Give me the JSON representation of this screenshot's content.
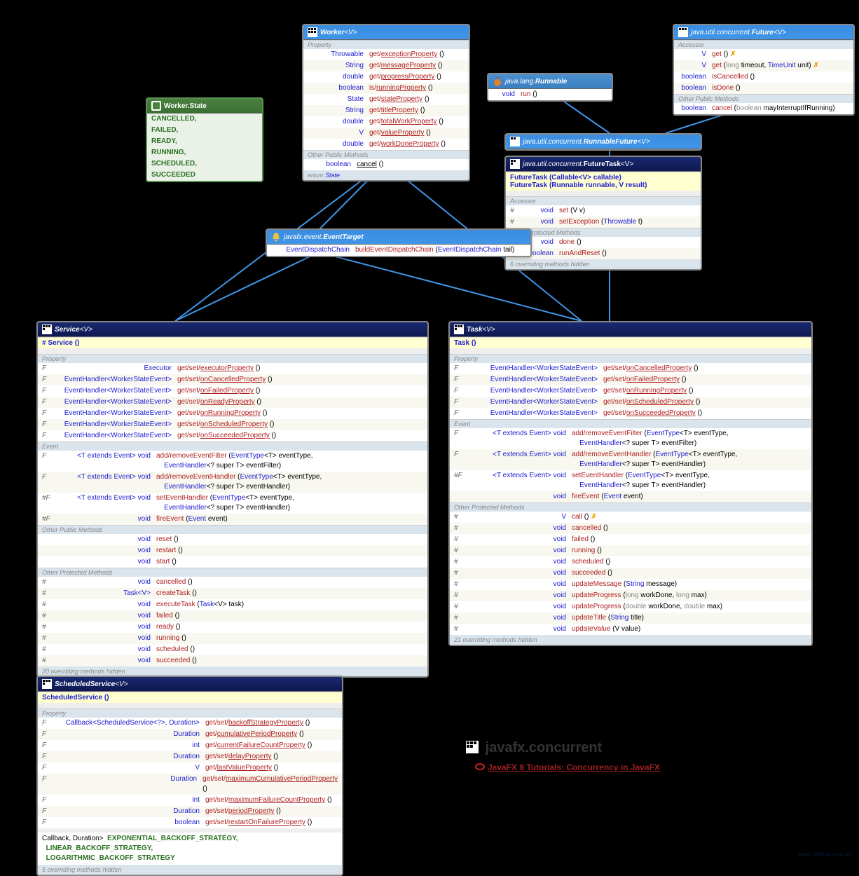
{
  "pkg_title": "javafx.concurrent",
  "tutorial_link": "JavaFX 8 Tutorials: Concurrency in JavaFX",
  "watermark": "www.falkhausen.de",
  "worker_state": {
    "title": "Worker.State",
    "items": [
      "CANCELLED,",
      "FAILED,",
      "READY,",
      "RUNNING,",
      "SCHEDULED,",
      "SUCCEEDED"
    ]
  },
  "worker": {
    "title_pre": "Worker",
    "title_post": "<V>",
    "sect_prop": "Property",
    "props": [
      {
        "ret": "Throwable",
        "sig": "get/<u>exceptionProperty</u> ()"
      },
      {
        "ret": "String",
        "sig": "get/<u>messageProperty</u> ()"
      },
      {
        "ret": "double",
        "sig": "get/<u>progressProperty</u> ()"
      },
      {
        "ret": "boolean",
        "sig": "is/<u>runningProperty</u> ()"
      },
      {
        "ret": "State",
        "sig": "get/<u>stateProperty</u> ()"
      },
      {
        "ret": "String",
        "sig": "get/<u>titleProperty</u> ()"
      },
      {
        "ret": "double",
        "sig": "get/<u>totalWorkProperty</u> ()"
      },
      {
        "ret": "V",
        "sig": "get/<u>valueProperty</u> ()"
      },
      {
        "ret": "double",
        "sig": "get/<u>workDoneProperty</u> ()"
      }
    ],
    "sect_other": "Other Public Methods",
    "other": [
      {
        "ret": "boolean",
        "sig": "<u>cancel</u> ()"
      }
    ],
    "foot": "enum <span class='type'>State</span>"
  },
  "runnable": {
    "title_pkg": "java.lang.",
    "title": "Runnable",
    "row": {
      "ret": "void",
      "sig": "<span class='m-name'>run</span> ()"
    }
  },
  "future": {
    "title_pkg": "java.util.concurrent.",
    "title_pre": "Future",
    "title_post": "<V>",
    "sect": "Accessor",
    "rows": [
      {
        "ret": "V",
        "sig": "<span class='m-name'>get</span> () <span class='excl'>✗</span>"
      },
      {
        "ret": "V",
        "sig": "<span class='m-name'>get</span> (<span class='kw'>long</span> timeout, <span class='type'>TimeUnit</span> unit) <span class='excl'>✗</span>"
      },
      {
        "ret": "boolean",
        "sig": "<span class='m-name'>isCancelled</span> ()"
      },
      {
        "ret": "boolean",
        "sig": "<span class='m-name'>isDone</span> ()"
      }
    ],
    "sect2": "Other Public Methods",
    "rows2": [
      {
        "ret": "boolean",
        "sig": "<span class='m-name'>cancel</span> (<span class='kw'>boolean</span> mayInterruptIfRunning)"
      }
    ]
  },
  "runnablefuture": {
    "title_pkg": "java.util.concurrent.",
    "title_pre": "RunnableFuture",
    "title_post": "<V>"
  },
  "futuretask": {
    "title_pkg": "java.util.concurrent.",
    "title_pre": "FutureTask",
    "title_post": "<V>",
    "constr": [
      "<span class='type'>FutureTask</span> (<span class='type'>Callable</span>&lt;V&gt; callable)",
      "<span class='type'>FutureTask</span> (<span class='type'>Runnable</span> runnable, V result)"
    ],
    "sect": "Accessor",
    "rows": [
      {
        "mod": "#",
        "ret": "void",
        "sig": "<span class='m-name'>set</span> (V v)"
      },
      {
        "mod": "#",
        "ret": "void",
        "sig": "<span class='m-name'>setException</span> (<span class='type'>Throwable</span> t)"
      }
    ],
    "sect2": "Other Protected Methods",
    "rows2": [
      {
        "mod": "#",
        "ret": "void",
        "sig": "<span class='m-name'>done</span> ()"
      },
      {
        "mod": "#",
        "ret": "boolean",
        "sig": "<span class='m-name'>runAndReset</span> ()"
      }
    ],
    "foot": "6 overriding <span class='note'>methods hidden</span>"
  },
  "eventtarget": {
    "title_pkg": "javafx.event.",
    "title": "EventTarget",
    "row": {
      "ret": "EventDispatchChain",
      "sig": "<span class='m-name'>buildEventDispatchChain</span> (<span class='type'>EventDispatchChain</span> tail)"
    }
  },
  "service": {
    "title_pre": "Service",
    "title_post": "<V>",
    "constr": "# <span class='type'>Service</span> ()",
    "sect_prop": "Property",
    "props": [
      {
        "mod": "F",
        "ret": "Executor",
        "sig": "get/set/<u>executorProperty</u> ()"
      },
      {
        "mod": "F",
        "ret": "EventHandler<WorkerStateEvent>",
        "sig": "get/set/<u>onCancelledProperty</u> ()"
      },
      {
        "mod": "F",
        "ret": "EventHandler<WorkerStateEvent>",
        "sig": "get/set/<u>onFailedProperty</u> ()"
      },
      {
        "mod": "F",
        "ret": "EventHandler<WorkerStateEvent>",
        "sig": "get/set/<u>onReadyProperty</u> ()"
      },
      {
        "mod": "F",
        "ret": "EventHandler<WorkerStateEvent>",
        "sig": "get/set/<u>onRunningProperty</u> ()"
      },
      {
        "mod": "F",
        "ret": "EventHandler<WorkerStateEvent>",
        "sig": "get/set/<u>onScheduledProperty</u> ()"
      },
      {
        "mod": "F",
        "ret": "EventHandler<WorkerStateEvent>",
        "sig": "get/set/<u>onSucceededProperty</u> ()"
      }
    ],
    "sect_event": "Event",
    "events": [
      {
        "mod": "F",
        "ret": "<T extends Event> void",
        "sig": "<span class='m-name'>add/removeEventFilter</span> (<span class='type'>EventType</span>&lt;T&gt; eventType,<br>&nbsp;&nbsp;&nbsp;&nbsp;<span class='type'>EventHandler</span>&lt;? super T&gt; eventFilter)"
      },
      {
        "mod": "F",
        "ret": "<T extends Event> void",
        "sig": "<span class='m-name'>add/removeEventHandler</span> (<span class='type'>EventType</span>&lt;T&gt; eventType,<br>&nbsp;&nbsp;&nbsp;&nbsp;<span class='type'>EventHandler</span>&lt;? super T&gt; eventHandler)"
      },
      {
        "mod": "#F",
        "ret": "<T extends Event> void",
        "sig": "<span class='m-name'>setEventHandler</span> (<span class='type'>EventType</span>&lt;T&gt; eventType,<br>&nbsp;&nbsp;&nbsp;&nbsp;<span class='type'>EventHandler</span>&lt;? super T&gt; eventHandler)"
      },
      {
        "mod": "#F",
        "ret": "void",
        "sig": "<span class='m-name'>fireEvent</span> (<span class='type'>Event</span> event)"
      }
    ],
    "sect_other": "Other Public Methods",
    "others": [
      {
        "ret": "void",
        "sig": "<span class='m-name'>reset</span> ()"
      },
      {
        "ret": "void",
        "sig": "<span class='m-name'>restart</span> ()"
      },
      {
        "ret": "void",
        "sig": "<span class='m-name'>start</span> ()"
      }
    ],
    "sect_prot": "Other Protected Methods",
    "prots": [
      {
        "mod": "#",
        "ret": "void",
        "sig": "<span class='m-name'>cancelled</span> ()"
      },
      {
        "mod": "#",
        "ret": "Task<V>",
        "sig": "<span class='m-name'>createTask</span> ()"
      },
      {
        "mod": "#",
        "ret": "void",
        "sig": "<span class='m-name'>executeTask</span> (<span class='type'>Task</span>&lt;V&gt; task)"
      },
      {
        "mod": "#",
        "ret": "void",
        "sig": "<span class='m-name'>failed</span> ()"
      },
      {
        "mod": "#",
        "ret": "void",
        "sig": "<span class='m-name'>ready</span> ()"
      },
      {
        "mod": "#",
        "ret": "void",
        "sig": "<span class='m-name'>running</span> ()"
      },
      {
        "mod": "#",
        "ret": "void",
        "sig": "<span class='m-name'>scheduled</span> ()"
      },
      {
        "mod": "#",
        "ret": "void",
        "sig": "<span class='m-name'>succeeded</span> ()"
      }
    ],
    "foot": "20 overriding <span class='note'>methods hidden</span>"
  },
  "task": {
    "title_pre": "Task",
    "title_post": "<V>",
    "constr": "<span class='type'>Task</span> ()",
    "sect_prop": "Property",
    "props": [
      {
        "mod": "F",
        "ret": "EventHandler<WorkerStateEvent>",
        "sig": "get/set/<u>onCancelledProperty</u> ()"
      },
      {
        "mod": "F",
        "ret": "EventHandler<WorkerStateEvent>",
        "sig": "get/set/<u>onFailedProperty</u> ()"
      },
      {
        "mod": "F",
        "ret": "EventHandler<WorkerStateEvent>",
        "sig": "get/set/<u>onRunningProperty</u> ()"
      },
      {
        "mod": "F",
        "ret": "EventHandler<WorkerStateEvent>",
        "sig": "get/set/<u>onScheduledProperty</u> ()"
      },
      {
        "mod": "F",
        "ret": "EventHandler<WorkerStateEvent>",
        "sig": "get/set/<u>onSucceededProperty</u> ()"
      }
    ],
    "sect_event": "Event",
    "events": [
      {
        "mod": "F",
        "ret": "<T extends Event> void",
        "sig": "<span class='m-name'>add/removeEventFilter</span> (<span class='type'>EventType</span>&lt;T&gt; eventType,<br>&nbsp;&nbsp;&nbsp;&nbsp;<span class='type'>EventHandler</span>&lt;? super T&gt; eventFilter)"
      },
      {
        "mod": "F",
        "ret": "<T extends Event> void",
        "sig": "<span class='m-name'>add/removeEventHandler</span> (<span class='type'>EventType</span>&lt;T&gt; eventType,<br>&nbsp;&nbsp;&nbsp;&nbsp;<span class='type'>EventHandler</span>&lt;? super T&gt; eventHandler)"
      },
      {
        "mod": "#F",
        "ret": "<T extends Event> void",
        "sig": "<span class='m-name'>setEventHandler</span> (<span class='type'>EventType</span>&lt;T&gt; eventType,<br>&nbsp;&nbsp;&nbsp;&nbsp;<span class='type'>EventHandler</span>&lt;? super T&gt; eventHandler)"
      },
      {
        "mod": "",
        "ret": "void",
        "sig": "<span class='m-name'>fireEvent</span> (<span class='type'>Event</span> event)"
      }
    ],
    "sect_prot": "Other Protected Methods",
    "prots": [
      {
        "mod": "#",
        "ret": "V",
        "sig": "<span class='m-name'>call</span> () <span class='excl'>✗</span>"
      },
      {
        "mod": "#",
        "ret": "void",
        "sig": "<span class='m-name'>cancelled</span> ()"
      },
      {
        "mod": "#",
        "ret": "void",
        "sig": "<span class='m-name'>failed</span> ()"
      },
      {
        "mod": "#",
        "ret": "void",
        "sig": "<span class='m-name'>running</span> ()"
      },
      {
        "mod": "#",
        "ret": "void",
        "sig": "<span class='m-name'>scheduled</span> ()"
      },
      {
        "mod": "#",
        "ret": "void",
        "sig": "<span class='m-name'>succeeded</span> ()"
      },
      {
        "mod": "#",
        "ret": "void",
        "sig": "<span class='m-name'>updateMessage</span> (<span class='type'>String</span> message)"
      },
      {
        "mod": "#",
        "ret": "void",
        "sig": "<span class='m-name'>updateProgress</span> (<span class='kw'>long</span> workDone, <span class='kw'>long</span> max)"
      },
      {
        "mod": "#",
        "ret": "void",
        "sig": "<span class='m-name'>updateProgress</span> (<span class='kw'>double</span> workDone, <span class='kw'>double</span> max)"
      },
      {
        "mod": "#",
        "ret": "void",
        "sig": "<span class='m-name'>updateTitle</span> (<span class='type'>String</span> title)"
      },
      {
        "mod": "#",
        "ret": "void",
        "sig": "<span class='m-name'>updateValue</span> (V value)"
      }
    ],
    "foot": "21 overriding <span class='note'>methods hidden</span>"
  },
  "scheduledservice": {
    "title_pre": "ScheduledService",
    "title_post": "<V>",
    "constr": "<span class='type'>ScheduledService</span> ()",
    "sect_prop": "Property",
    "props": [
      {
        "mod": "F",
        "ret": "Callback<ScheduledService<?>, Duration>",
        "sig": "get/set/<u>backoffStrategyProperty</u> ()"
      },
      {
        "mod": "F",
        "ret": "Duration",
        "sig": "get/<u>cumulativePeriodProperty</u> ()"
      },
      {
        "mod": "F",
        "ret": "int",
        "sig": "get/<u>currentFailureCountProperty</u> ()"
      },
      {
        "mod": "F",
        "ret": "Duration",
        "sig": "get/set/<u>delayProperty</u> ()"
      },
      {
        "mod": "F",
        "ret": "V",
        "sig": "get/<u>lastValueProperty</u> ()"
      },
      {
        "mod": "F",
        "ret": "Duration",
        "sig": "get/set/<u>maximumCumulativePeriodProperty</u> ()"
      },
      {
        "mod": "F",
        "ret": "int",
        "sig": "get/set/<u>maximumFailureCountProperty</u> ()"
      },
      {
        "mod": "F",
        "ret": "Duration",
        "sig": "get/set/<u>periodProperty</u> ()"
      },
      {
        "mod": "F",
        "ret": "boolean",
        "sig": "get/set/<u>restartOnFailureProperty</u> ()"
      }
    ],
    "consts": [
      "Callback<ScheduledService<?>, Duration>&nbsp;&nbsp;<span class='green-const'>EXPONENTIAL_BACKOFF_STRATEGY,</span>",
      "&nbsp;&nbsp;<span class='green-const'>LINEAR_BACKOFF_STRATEGY,</span>",
      "&nbsp;&nbsp;<span class='green-const'>LOGARITHMIC_BACKOFF_STRATEGY</span>"
    ],
    "foot": "5 overriding <span class='note'>methods hidden</span>"
  }
}
